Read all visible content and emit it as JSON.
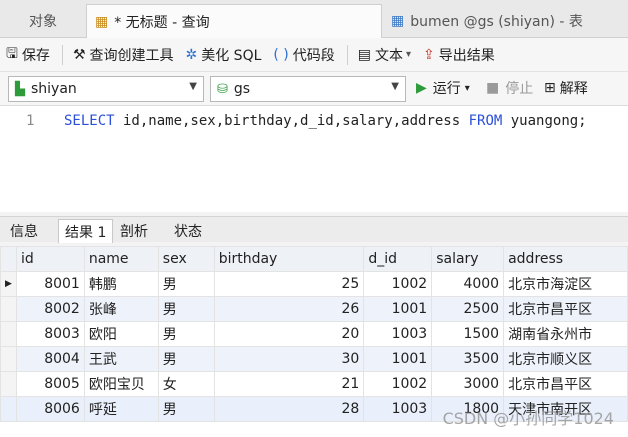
{
  "tabs": {
    "objects": "对象",
    "query": "* 无标题 - 查询",
    "table": "bumen @gs (shiyan) - 表"
  },
  "toolbar": {
    "save": "保存",
    "query_builder": "查询创建工具",
    "beautify": "美化 SQL",
    "snippet": "代码段",
    "text": "文本",
    "export": "导出结果"
  },
  "connection": {
    "value": "shiyan"
  },
  "database": {
    "value": "gs"
  },
  "run": {
    "run": "运行",
    "stop": "停止",
    "explain": "解释"
  },
  "editor": {
    "line": "1",
    "sql_select": "SELECT",
    "sql_cols": " id,name,sex,birthday,d_id,salary,address ",
    "sql_from": "FROM",
    "sql_table": " yuangong;"
  },
  "result_tabs": [
    "信息",
    "结果 1",
    "剖析",
    "状态"
  ],
  "grid": {
    "columns": [
      "id",
      "name",
      "sex",
      "birthday",
      "d_id",
      "salary",
      "address"
    ],
    "rows": [
      [
        "8001",
        "韩鹏",
        "男",
        "25",
        "1002",
        "4000",
        "北京市海淀区"
      ],
      [
        "8002",
        "张峰",
        "男",
        "26",
        "1001",
        "2500",
        "北京市昌平区"
      ],
      [
        "8003",
        "欧阳",
        "男",
        "20",
        "1003",
        "1500",
        "湖南省永州市"
      ],
      [
        "8004",
        "王武",
        "男",
        "30",
        "1001",
        "3500",
        "北京市顺义区"
      ],
      [
        "8005",
        "欧阳宝贝",
        "女",
        "21",
        "1002",
        "3000",
        "北京市昌平区"
      ],
      [
        "8006",
        "呼延",
        "男",
        "28",
        "1003",
        "1800",
        "天津市南开区"
      ]
    ]
  },
  "watermark": "CSDN @小孙同学1024"
}
